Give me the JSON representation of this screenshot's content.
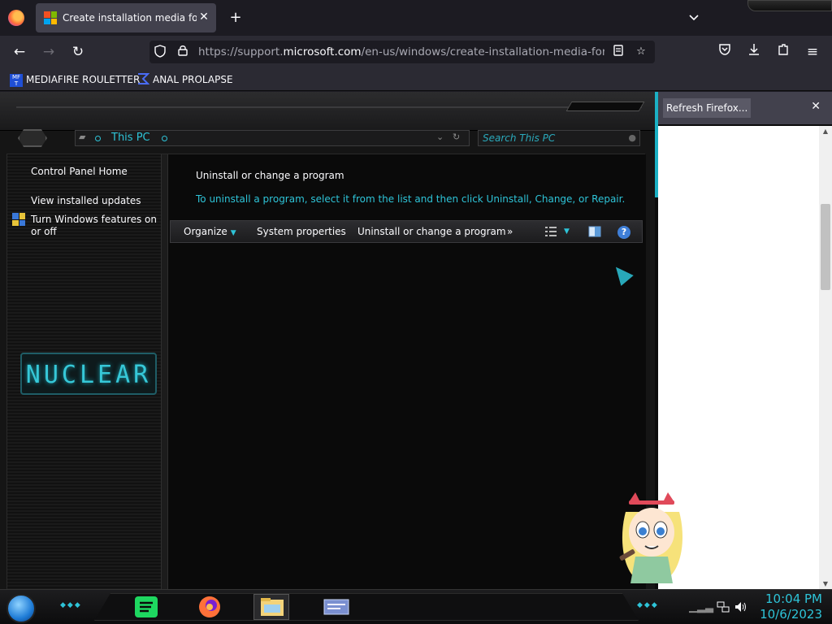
{
  "browser": {
    "tab": {
      "title": "Create installation media for Wi",
      "close": "✕"
    },
    "new_tab": "+",
    "tab_list": "⌄",
    "url": {
      "prefix": "https://support.",
      "domain": "microsoft.com",
      "path": "/en-us/windows/create-installation-media-for-windo"
    },
    "bookmarks": [
      {
        "label": "MEDIAFIRE ROULETTER"
      },
      {
        "label": "ANAL PROLAPSE"
      }
    ]
  },
  "explorer": {
    "breadcrumb": "This PC",
    "search_placeholder": "Search This PC",
    "left_pane": {
      "links": [
        "Control Panel Home",
        "View installed updates",
        "Turn Windows features on or off"
      ]
    },
    "logo_text": "NUCLEAR",
    "content": {
      "title": "Uninstall or change a program",
      "subtitle": "To uninstall a program, select it from the list and then click Uninstall, Change, or Repair."
    },
    "command_bar": {
      "organize": "Organize",
      "system_properties": "System properties",
      "uninstall_change": "Uninstall or change a program",
      "more": "»",
      "help": "?"
    }
  },
  "notification": {
    "label": "Refresh Firefox...",
    "close": "✕"
  },
  "taskbar": {
    "clock_time": "10:04 PM",
    "clock_date": "10/6/2023"
  },
  "colors": {
    "accent": "#2ec4d8",
    "browser_bg": "#2b2a33",
    "tab_active": "#42414d"
  }
}
